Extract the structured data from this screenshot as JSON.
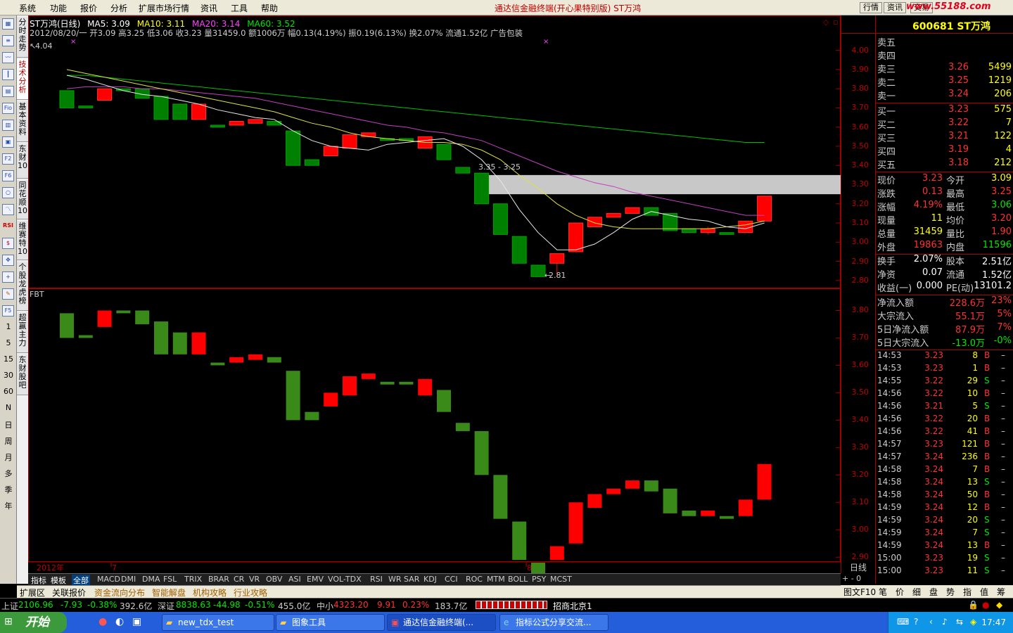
{
  "menu": [
    "系统",
    "功能",
    "报价",
    "分析",
    "扩展市场行情",
    "资讯",
    "工具",
    "帮助"
  ],
  "app_title": "通达信金融终端(开心果特别版)  ST万鸿",
  "top_right": {
    "hq": "行情",
    "zx": "资讯",
    "jy": "交易",
    "brand": "www.55188.com"
  },
  "side_tabs": [
    "分时走势",
    "技术分析",
    "基本资料",
    "东财10",
    "同花顺10",
    "维赛特10",
    "个股龙虎榜",
    "超赢主力",
    "东财股吧"
  ],
  "period_buttons": [
    "1",
    "5",
    "15",
    "30",
    "60",
    "N",
    "日",
    "周",
    "月",
    "多",
    "季",
    "年"
  ],
  "toolbar_icons": [
    "Fio",
    "F2",
    "F6",
    "RSI",
    "F5"
  ],
  "header": {
    "name": "ST万鸿(日线)",
    "ma5": "MA5: 3.09",
    "ma10": "MA10: 3.11",
    "ma20": "MA20: 3.14",
    "ma60": "MA60: 3.52",
    "line2": "2012/08/20/一 开3.09 高3.25 低3.06 收3.23 量31459.0 额1006万 幅0.13(4.19%) 振0.19(6.13%) 换2.07% 流通1.52亿 广告包装",
    "hi_label": "4.04",
    "lo_label": "2.81",
    "zone_label": "3.35 - 3.25"
  },
  "sub_title": "FBT",
  "date_axis": {
    "year": "2012年",
    "m1": "7",
    "m2": "8",
    "period": "日线"
  },
  "axis_main": [
    "4.00",
    "3.90",
    "3.80",
    "3.70",
    "3.60",
    "3.50",
    "3.40",
    "3.30",
    "3.20",
    "3.10",
    "3.00",
    "2.90",
    "2.80"
  ],
  "axis_sub": [
    "3.80",
    "3.70",
    "3.60",
    "3.50",
    "3.40",
    "3.30",
    "3.20",
    "3.10",
    "3.00",
    "2.90"
  ],
  "chart_data": {
    "type": "candlestick",
    "ylim_main": [
      2.77,
      4.05
    ],
    "ylim_sub": [
      2.88,
      3.85
    ],
    "candles": [
      {
        "o": 3.79,
        "h": 3.79,
        "l": 3.7,
        "c": 3.7
      },
      {
        "o": 3.71,
        "h": 3.71,
        "l": 3.7,
        "c": 3.7
      },
      {
        "o": 3.74,
        "h": 3.8,
        "l": 3.74,
        "c": 3.8
      },
      {
        "o": 3.8,
        "h": 3.8,
        "l": 3.79,
        "c": 3.79
      },
      {
        "o": 3.8,
        "h": 3.8,
        "l": 3.75,
        "c": 3.75
      },
      {
        "o": 3.76,
        "h": 3.76,
        "l": 3.64,
        "c": 3.64
      },
      {
        "o": 3.72,
        "h": 3.72,
        "l": 3.64,
        "c": 3.64
      },
      {
        "o": 3.64,
        "h": 3.72,
        "l": 3.64,
        "c": 3.72
      },
      {
        "o": 3.61,
        "h": 3.61,
        "l": 3.6,
        "c": 3.6
      },
      {
        "o": 3.61,
        "h": 3.63,
        "l": 3.61,
        "c": 3.63
      },
      {
        "o": 3.62,
        "h": 3.64,
        "l": 3.62,
        "c": 3.64
      },
      {
        "o": 3.63,
        "h": 3.63,
        "l": 3.61,
        "c": 3.61
      },
      {
        "o": 3.58,
        "h": 3.58,
        "l": 3.4,
        "c": 3.4
      },
      {
        "o": 3.43,
        "h": 3.43,
        "l": 3.4,
        "c": 3.4
      },
      {
        "o": 3.45,
        "h": 3.5,
        "l": 3.45,
        "c": 3.5
      },
      {
        "o": 3.49,
        "h": 3.56,
        "l": 3.49,
        "c": 3.56
      },
      {
        "o": 3.55,
        "h": 3.57,
        "l": 3.55,
        "c": 3.57
      },
      {
        "o": 3.54,
        "h": 3.54,
        "l": 3.53,
        "c": 3.53
      },
      {
        "o": 3.54,
        "h": 3.54,
        "l": 3.53,
        "c": 3.53
      },
      {
        "o": 3.49,
        "h": 3.55,
        "l": 3.49,
        "c": 3.55
      },
      {
        "o": 3.51,
        "h": 3.51,
        "l": 3.43,
        "c": 3.43
      },
      {
        "o": 3.39,
        "h": 3.39,
        "l": 3.36,
        "c": 3.36
      },
      {
        "o": 3.36,
        "h": 3.36,
        "l": 3.2,
        "c": 3.2
      },
      {
        "o": 3.2,
        "h": 3.2,
        "l": 3.04,
        "c": 3.04
      },
      {
        "o": 3.03,
        "h": 3.03,
        "l": 2.89,
        "c": 2.89
      },
      {
        "o": 2.88,
        "h": 2.88,
        "l": 2.82,
        "c": 2.82
      },
      {
        "o": 2.89,
        "h": 2.94,
        "l": 2.82,
        "c": 2.94
      },
      {
        "o": 2.95,
        "h": 3.1,
        "l": 2.95,
        "c": 3.1
      },
      {
        "o": 3.08,
        "h": 3.13,
        "l": 3.08,
        "c": 3.13
      },
      {
        "o": 3.13,
        "h": 3.15,
        "l": 3.13,
        "c": 3.15
      },
      {
        "o": 3.15,
        "h": 3.18,
        "l": 3.15,
        "c": 3.18
      },
      {
        "o": 3.18,
        "h": 3.18,
        "l": 3.14,
        "c": 3.14
      },
      {
        "o": 3.15,
        "h": 3.15,
        "l": 3.06,
        "c": 3.06
      },
      {
        "o": 3.07,
        "h": 3.07,
        "l": 3.05,
        "c": 3.05
      },
      {
        "o": 3.05,
        "h": 3.08,
        "l": 3.04,
        "c": 3.07
      },
      {
        "o": 3.05,
        "h": 3.05,
        "l": 3.04,
        "c": 3.04
      },
      {
        "o": 3.05,
        "h": 3.11,
        "l": 3.05,
        "c": 3.11
      },
      {
        "o": 3.11,
        "h": 3.24,
        "l": 3.11,
        "c": 3.24
      }
    ],
    "ma5": [
      3.87,
      3.85,
      3.82,
      3.79,
      3.77,
      3.76,
      3.74,
      3.72,
      3.69,
      3.67,
      3.65,
      3.64,
      3.58,
      3.53,
      3.5,
      3.49,
      3.48,
      3.51,
      3.52,
      3.53,
      3.54,
      3.5,
      3.43,
      3.32,
      3.17,
      3.05,
      2.96,
      2.96,
      2.99,
      3.05,
      3.12,
      3.16,
      3.14,
      3.12,
      3.11,
      3.08,
      3.07,
      3.1
    ],
    "ma10": [
      3.9,
      3.88,
      3.86,
      3.84,
      3.82,
      3.8,
      3.78,
      3.76,
      3.74,
      3.72,
      3.7,
      3.68,
      3.65,
      3.62,
      3.6,
      3.57,
      3.55,
      3.54,
      3.53,
      3.52,
      3.52,
      3.51,
      3.48,
      3.43,
      3.35,
      3.28,
      3.2,
      3.14,
      3.1,
      3.08,
      3.07,
      3.07,
      3.07,
      3.07,
      3.07,
      3.08,
      3.09,
      3.11
    ],
    "ma20": [
      3.8,
      3.81,
      3.81,
      3.81,
      3.8,
      3.8,
      3.79,
      3.78,
      3.77,
      3.76,
      3.75,
      3.73,
      3.71,
      3.69,
      3.67,
      3.65,
      3.63,
      3.61,
      3.6,
      3.58,
      3.57,
      3.55,
      3.53,
      3.49,
      3.45,
      3.41,
      3.37,
      3.34,
      3.31,
      3.29,
      3.26,
      3.24,
      3.22,
      3.2,
      3.18,
      3.16,
      3.14,
      3.14
    ],
    "ma60": [
      3.87,
      3.87,
      3.86,
      3.85,
      3.84,
      3.83,
      3.82,
      3.81,
      3.8,
      3.79,
      3.78,
      3.77,
      3.76,
      3.75,
      3.74,
      3.73,
      3.72,
      3.71,
      3.7,
      3.69,
      3.68,
      3.67,
      3.66,
      3.65,
      3.64,
      3.63,
      3.62,
      3.61,
      3.6,
      3.59,
      3.58,
      3.57,
      3.56,
      3.55,
      3.54,
      3.53,
      3.52,
      3.52
    ],
    "zone": [
      3.25,
      3.35
    ]
  },
  "quote": {
    "code": "600681 ST万鸿",
    "sells": [
      {
        "l": "卖五",
        "p": "",
        "v": ""
      },
      {
        "l": "卖四",
        "p": "",
        "v": ""
      },
      {
        "l": "卖三",
        "p": "3.26",
        "v": "5499"
      },
      {
        "l": "卖二",
        "p": "3.25",
        "v": "1219"
      },
      {
        "l": "卖一",
        "p": "3.24",
        "v": "206"
      }
    ],
    "buys": [
      {
        "l": "买一",
        "p": "3.23",
        "v": "575"
      },
      {
        "l": "买二",
        "p": "3.22",
        "v": "7"
      },
      {
        "l": "买三",
        "p": "3.21",
        "v": "122"
      },
      {
        "l": "买四",
        "p": "3.19",
        "v": "4"
      },
      {
        "l": "买五",
        "p": "3.18",
        "v": "212"
      }
    ],
    "stats": [
      {
        "l": "现价",
        "v": "3.23",
        "c": "red",
        "l2": "今开",
        "v2": "3.09",
        "c2": "yel"
      },
      {
        "l": "涨跌",
        "v": "0.13",
        "c": "red",
        "l2": "最高",
        "v2": "3.25",
        "c2": "red"
      },
      {
        "l": "涨幅",
        "v": "4.19%",
        "c": "red",
        "l2": "最低",
        "v2": "3.06",
        "c2": "grn"
      },
      {
        "l": "现量",
        "v": "11",
        "c": "yel",
        "l2": "均价",
        "v2": "3.20",
        "c2": "red"
      },
      {
        "l": "总量",
        "v": "31459",
        "c": "yel",
        "l2": "量比",
        "v2": "1.90",
        "c2": "red"
      },
      {
        "l": "外盘",
        "v": "19863",
        "c": "red",
        "l2": "内盘",
        "v2": "11596",
        "c2": "grn"
      }
    ],
    "stats2": [
      {
        "l": "换手",
        "v": "2.07%",
        "l2": "股本",
        "v2": "2.51亿"
      },
      {
        "l": "净资",
        "v": "0.07",
        "l2": "流通",
        "v2": "1.52亿"
      },
      {
        "l": "收益(一)",
        "v": "0.000",
        "l2": "PE(动)",
        "v2": "13101.2"
      }
    ],
    "flows": [
      {
        "l": "净流入额",
        "a": "228.6万",
        "b": "23%",
        "c": "red"
      },
      {
        "l": "大宗流入",
        "a": "55.1万",
        "b": "5%",
        "c": "red"
      },
      {
        "l": "5日净流入额",
        "a": "87.9万",
        "b": "7%",
        "c": "red"
      },
      {
        "l": "5日大宗流入",
        "a": "-13.0万",
        "b": "-0%",
        "c": "grn"
      }
    ],
    "ticks": [
      {
        "t": "14:53",
        "p": "3.23",
        "q": "8",
        "s": "B"
      },
      {
        "t": "14:53",
        "p": "3.23",
        "q": "1",
        "s": "B"
      },
      {
        "t": "14:55",
        "p": "3.22",
        "q": "29",
        "s": "S"
      },
      {
        "t": "14:56",
        "p": "3.22",
        "q": "10",
        "s": "B"
      },
      {
        "t": "14:56",
        "p": "3.21",
        "q": "5",
        "s": "S"
      },
      {
        "t": "14:56",
        "p": "3.22",
        "q": "20",
        "s": "B"
      },
      {
        "t": "14:56",
        "p": "3.22",
        "q": "41",
        "s": "B"
      },
      {
        "t": "14:57",
        "p": "3.23",
        "q": "121",
        "s": "B"
      },
      {
        "t": "14:57",
        "p": "3.24",
        "q": "236",
        "s": "B"
      },
      {
        "t": "14:58",
        "p": "3.24",
        "q": "7",
        "s": "B"
      },
      {
        "t": "14:58",
        "p": "3.24",
        "q": "13",
        "s": "S"
      },
      {
        "t": "14:58",
        "p": "3.24",
        "q": "50",
        "s": "B"
      },
      {
        "t": "14:59",
        "p": "3.24",
        "q": "12",
        "s": "B"
      },
      {
        "t": "14:59",
        "p": "3.24",
        "q": "20",
        "s": "S"
      },
      {
        "t": "14:59",
        "p": "3.24",
        "q": "7",
        "s": "S"
      },
      {
        "t": "14:59",
        "p": "3.24",
        "q": "13",
        "s": "B"
      },
      {
        "t": "15:00",
        "p": "3.23",
        "q": "19",
        "s": "S"
      },
      {
        "t": "15:00",
        "p": "3.23",
        "q": "11",
        "s": "S"
      }
    ]
  },
  "indicator_tabs": [
    "指标",
    "模板",
    "全部",
    "MACD",
    "DMI",
    "DMA",
    "FSL",
    "TRIX",
    "BRAR",
    "CR",
    "VR",
    "OBV",
    "ASI",
    "EMV",
    "VOL-TDX",
    "RSI",
    "WR",
    "SAR",
    "KDJ",
    "CCI",
    "ROC",
    "MTM",
    "BOLL",
    "PSY",
    "MCST"
  ],
  "bottom_tabs": [
    "扩展区",
    "关联报价",
    "资金流向分布",
    "智能解盘",
    "机构攻略",
    "行业攻略"
  ],
  "right_bottom_tabs": [
    "图文F10",
    "笔",
    "价",
    "细",
    "盘",
    "势",
    "指",
    "值",
    "筹"
  ],
  "statusbar": {
    "sh": "上证",
    "sh_v": "2106.96",
    "sh_c": "-7.93",
    "sh_p": "-0.38%",
    "sh_a": "392.6亿",
    "sz": "深证",
    "sz_v": "8838.63",
    "sz_c": "-44.98",
    "sz_p": "-0.51%",
    "sz_a": "455.0亿",
    "zx": "中小",
    "zx_v": "4323.20",
    "zx_c": "9.91",
    "zx_p": "0.23%",
    "zx_a": "183.7亿",
    "broker": "招商北京1"
  },
  "taskbar": {
    "start": "开始",
    "tasks": [
      "new_tdx_test",
      "图象工具",
      "通达信金融终端(...",
      "指标公式分享交流..."
    ],
    "clock": "17:47"
  }
}
